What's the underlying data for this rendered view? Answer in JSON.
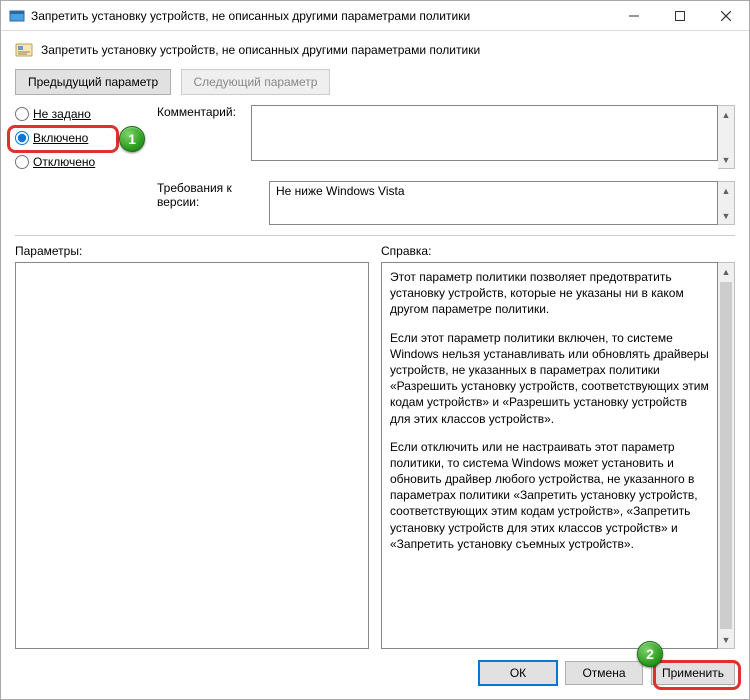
{
  "window_title": "Запретить установку устройств, не описанных другими параметрами политики",
  "header_title": "Запретить установку устройств, не описанных другими параметрами политики",
  "nav": {
    "prev": "Предыдущий параметр",
    "next": "Следующий параметр"
  },
  "state": {
    "not_configured": "Не задано",
    "enabled": "Включено",
    "disabled": "Отключено",
    "selected": "enabled"
  },
  "comment": {
    "label": "Комментарий:",
    "value": ""
  },
  "requirements": {
    "label": "Требования к версии:",
    "value": "Не ниже Windows Vista"
  },
  "options": {
    "label": "Параметры:"
  },
  "help": {
    "label": "Справка:",
    "p1": "Этот параметр политики позволяет предотвратить установку устройств, которые не указаны ни в каком другом параметре политики.",
    "p2": "Если этот параметр политики включен, то системе Windows нельзя устанавливать или обновлять драйверы устройств, не указанных в параметрах политики «Разрешить установку устройств, соответствующих этим кодам устройств» и «Разрешить установку устройств для этих классов устройств».",
    "p3": "Если отключить или не настраивать этот параметр политики, то система Windows может установить и обновить драйвер любого устройства, не указанного в параметрах политики «Запретить установку устройств, соответствующих этим кодам устройств», «Запретить установку устройств для этих классов устройств» и «Запретить установку съемных устройств»."
  },
  "footer": {
    "ok": "ОК",
    "cancel": "Отмена",
    "apply": "Применить"
  },
  "badges": {
    "one": "1",
    "two": "2"
  }
}
